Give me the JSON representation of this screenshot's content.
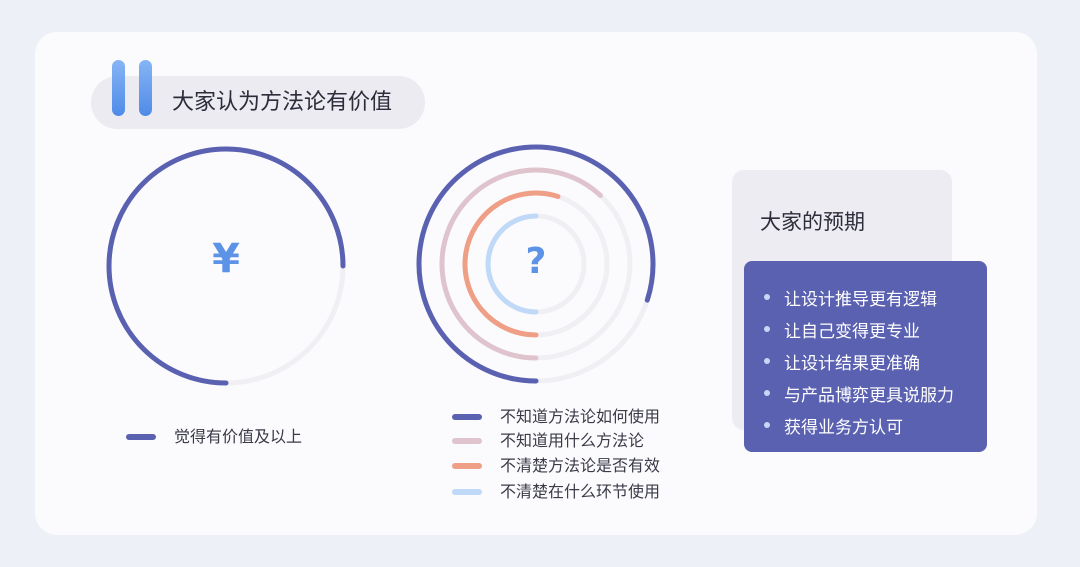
{
  "header": {
    "title": "大家认为方法论有价值"
  },
  "colors": {
    "accent_blue": "#5d93e6",
    "navy": "#5a61b0",
    "track": "#f0eff4"
  },
  "chart_data": [
    {
      "type": "pie",
      "center_symbol": "¥",
      "series": [
        {
          "name": "觉得有价值及以上",
          "value": 0.75,
          "color": "#5a61b0"
        }
      ],
      "legend": [
        "觉得有价值及以上"
      ]
    },
    {
      "type": "pie",
      "center_symbol": "?",
      "series": [
        {
          "name": "不知道方法论如何使用",
          "value": 0.8,
          "color": "#5a61b0"
        },
        {
          "name": "不知道用什么方法论",
          "value": 0.62,
          "color": "#dfc4cd"
        },
        {
          "name": "不清楚方法论是否有效",
          "value": 0.55,
          "color": "#ef9f86"
        },
        {
          "name": "不清楚在什么环节使用",
          "value": 0.5,
          "color": "#bfd9f7"
        }
      ],
      "legend": [
        "不知道方法论如何使用",
        "不知道用什么方法论",
        "不清楚方法论是否有效",
        "不清楚在什么环节使用"
      ]
    }
  ],
  "expectations": {
    "title": "大家的预期",
    "items": [
      "让设计推导更有逻辑",
      "让自己变得更专业",
      "让设计结果更准确",
      "与产品博弈更具说服力",
      "获得业务方认可"
    ]
  }
}
